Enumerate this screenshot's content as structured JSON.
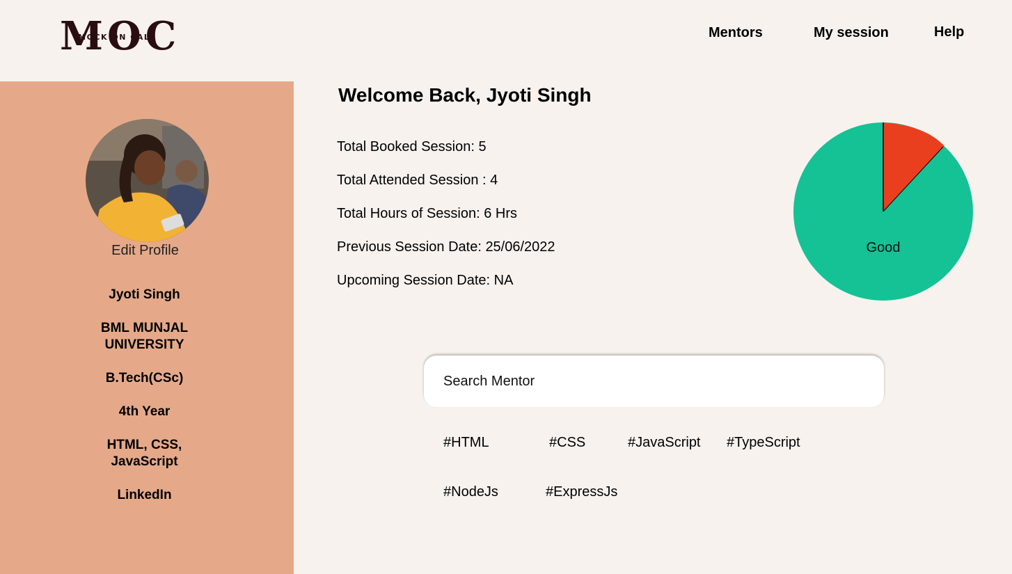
{
  "header": {
    "logo_big": "MOC",
    "logo_small": "MOCK ON CALL",
    "nav": {
      "mentors": "Mentors",
      "my_session": "My session",
      "help": "Help"
    }
  },
  "sidebar": {
    "edit_profile": "Edit Profile",
    "name": "Jyoti Singh",
    "university": "BML MUNJAL UNIVERSITY",
    "degree": "B.Tech(CSc)",
    "year": "4th Year",
    "skills": "HTML, CSS, JavaScript",
    "linkedin": "LinkedIn"
  },
  "main": {
    "welcome": "Welcome Back, Jyoti Singh",
    "stats": {
      "booked": "Total Booked Session: 5",
      "attended": "Total Attended Session : 4",
      "hours": "Total Hours of Session: 6 Hrs",
      "previous": "Previous Session Date: 25/06/2022",
      "upcoming": "Upcoming Session Date: NA"
    },
    "pie_label": "Good",
    "search_placeholder": "Search Mentor",
    "tags": [
      "#HTML",
      "#CSS",
      "#JavaScript",
      "#TypeScript",
      "#NodeJs",
      "#ExpressJs"
    ]
  },
  "colors": {
    "background": "#f7f2ee",
    "sidebar": "#e5a989",
    "pie_good": "#14c295",
    "pie_other": "#ea3f1e"
  }
}
